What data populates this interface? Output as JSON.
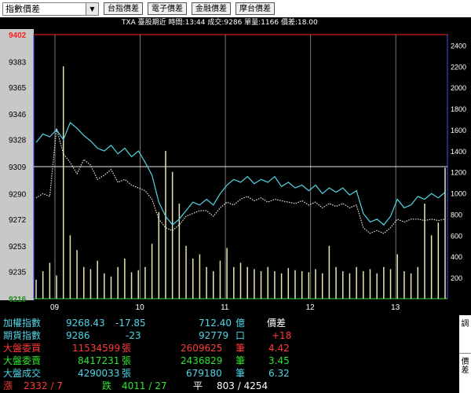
{
  "toolbar": {
    "selector_value": "指數價差",
    "buttons": [
      "台指價差",
      "電子價差",
      "金融價差",
      "摩台價差"
    ]
  },
  "infobar": {
    "text": "TXA 臺股期近 時間:13:44 成交:9286 單量:1166 價差:18.00"
  },
  "chart_data": {
    "type": "line",
    "y_ticks": [
      "9402",
      "9383",
      "9365",
      "9346",
      "9328",
      "9309",
      "9290",
      "9272",
      "9253",
      "9235",
      "9216"
    ],
    "y_range": [
      9216,
      9402
    ],
    "volume_ticks": [
      "2400",
      "2200",
      "2000",
      "1800",
      "1600",
      "1400",
      "1200",
      "1000",
      "800",
      "600",
      "400",
      "200"
    ],
    "volume_range": [
      0,
      2500
    ],
    "x_ticks": [
      "09",
      "10",
      "11",
      "12",
      "13"
    ],
    "reference_price": 9309,
    "highlight_tick": "9402",
    "series": [
      {
        "color": "#4fd6e6",
        "style": "solid",
        "x": [
          0,
          1,
          2,
          3,
          4,
          5,
          6,
          7,
          8,
          9,
          10,
          11,
          12,
          13,
          14,
          15,
          16,
          17,
          18,
          19,
          20,
          21,
          22,
          23,
          24,
          25,
          26,
          27,
          28,
          29,
          30,
          31,
          32,
          33,
          34,
          35,
          36,
          37,
          38,
          39,
          40,
          41,
          42,
          43,
          44,
          45,
          46,
          47,
          48,
          49,
          50,
          51,
          52,
          53,
          54,
          55,
          56,
          57,
          58,
          59,
          60
        ],
        "values": [
          9326,
          9332,
          9330,
          9335,
          9328,
          9340,
          9336,
          9331,
          9327,
          9322,
          9320,
          9324,
          9318,
          9322,
          9316,
          9320,
          9312,
          9303,
          9284,
          9274,
          9268,
          9272,
          9278,
          9284,
          9282,
          9286,
          9282,
          9290,
          9296,
          9300,
          9298,
          9302,
          9297,
          9300,
          9298,
          9302,
          9295,
          9298,
          9294,
          9296,
          9292,
          9296,
          9290,
          9294,
          9291,
          9294,
          9289,
          9292,
          9276,
          9270,
          9272,
          9268,
          9274,
          9286,
          9280,
          9282,
          9288,
          9286,
          9290,
          9287,
          9291
        ]
      },
      {
        "color": "#e6e6e6",
        "style": "dotted",
        "x": [
          0,
          1,
          2,
          3,
          4,
          5,
          6,
          7,
          8,
          9,
          10,
          11,
          12,
          13,
          14,
          15,
          16,
          17,
          18,
          19,
          20,
          21,
          22,
          23,
          24,
          25,
          26,
          27,
          28,
          29,
          30,
          31,
          32,
          33,
          34,
          35,
          36,
          37,
          38,
          39,
          40,
          41,
          42,
          43,
          44,
          45,
          46,
          47,
          48,
          49,
          50,
          51,
          52,
          53,
          54,
          55,
          56,
          57,
          58,
          59,
          60
        ],
        "values": [
          9287,
          9290,
          9288,
          9336,
          9318,
          9312,
          9304,
          9314,
          9310,
          9300,
          9303,
          9307,
          9298,
          9300,
          9296,
          9294,
          9292,
          9286,
          9272,
          9266,
          9264,
          9268,
          9274,
          9276,
          9278,
          9278,
          9274,
          9280,
          9284,
          9282,
          9286,
          9288,
          9285,
          9287,
          9284,
          9286,
          9285,
          9284,
          9283,
          9285,
          9282,
          9284,
          9280,
          9283,
          9281,
          9283,
          9280,
          9282,
          9266,
          9262,
          9264,
          9262,
          9266,
          9272,
          9270,
          9272,
          9272,
          9271,
          9272,
          9271,
          9272
        ]
      }
    ],
    "volume": [
      180,
      260,
      340,
      220,
      2200,
      600,
      460,
      300,
      280,
      360,
      240,
      210,
      300,
      380,
      250,
      270,
      300,
      520,
      820,
      1400,
      1200,
      900,
      500,
      380,
      420,
      300,
      260,
      360,
      480,
      300,
      340,
      300,
      280,
      260,
      300,
      260,
      240,
      290,
      270,
      260,
      250,
      280,
      240,
      500,
      300,
      260,
      240,
      300,
      260,
      280,
      240,
      300,
      280,
      420,
      260,
      240,
      300,
      900,
      600,
      720,
      1240
    ]
  },
  "quotes": [
    {
      "name": "加權指數",
      "v1": "9268.43",
      "v2": "-17.85",
      "v3": "712.40",
      "u3": "億",
      "v4": "價差",
      "color": "#4fd6e6"
    },
    {
      "name": "期貨指數",
      "v1": "9286",
      "v2": "-23",
      "v3": "92779",
      "u3": "口",
      "v4": "+18",
      "color": "#4fd6e6"
    },
    {
      "name": "大盤委買",
      "v1": "11534599",
      "u1": "張",
      "v3": "2609625",
      "u3": "筆",
      "v4": "4.42",
      "color": "#ff3a3a"
    },
    {
      "name": "大盤委賣",
      "v1": "8417231",
      "u1": "張",
      "v3": "2436829",
      "u3": "筆",
      "v4": "3.45",
      "color": "#2ee62e"
    },
    {
      "name": "大盤成交",
      "v1": "4290033",
      "u1": "張",
      "v3": "679180",
      "u3": "筆",
      "v4": "6.32",
      "color": "#4fd6e6"
    },
    {
      "name": "漲",
      "v1": "2332 / 7",
      "mid_label": "跌",
      "mid_value": "4011 / 27",
      "flat_label": "平",
      "flat_value": "803 / 4254"
    }
  ],
  "side_tabs": [
    "調",
    "價差"
  ]
}
